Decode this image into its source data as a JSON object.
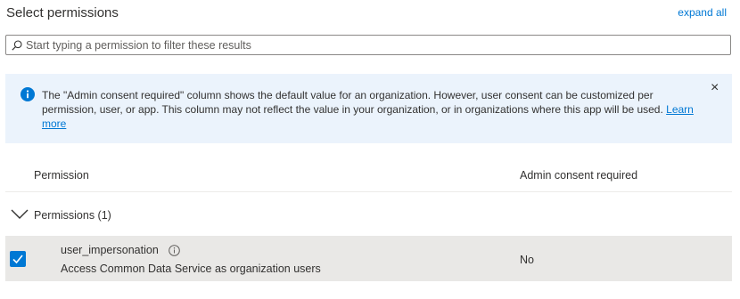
{
  "header": {
    "title": "Select permissions",
    "expand_label": "expand all"
  },
  "search": {
    "placeholder": "Start typing a permission to filter these results",
    "value": ""
  },
  "banner": {
    "text": "The \"Admin consent required\" column shows the default value for an organization. However, user consent can be customized per permission, user, or app. This column may not reflect the value in your organization, or in organizations where this app will be used.",
    "link": "Learn more",
    "close_glyph": "×"
  },
  "table": {
    "columns": [
      "Permission",
      "Admin consent required"
    ],
    "group_label": "Permissions (1)",
    "rows": [
      {
        "name": "user_impersonation",
        "description": "Access Common Data Service as organization users",
        "admin_consent": "No",
        "checked": true
      }
    ]
  },
  "colors": {
    "accent": "#0078d4",
    "banner_bg": "#ebf3fc",
    "selected_row_bg": "#e9e8e6"
  },
  "icons": [
    "search-icon",
    "info-icon",
    "close-icon",
    "chevron-down-icon",
    "checkmark-icon",
    "info-outline-icon"
  ]
}
